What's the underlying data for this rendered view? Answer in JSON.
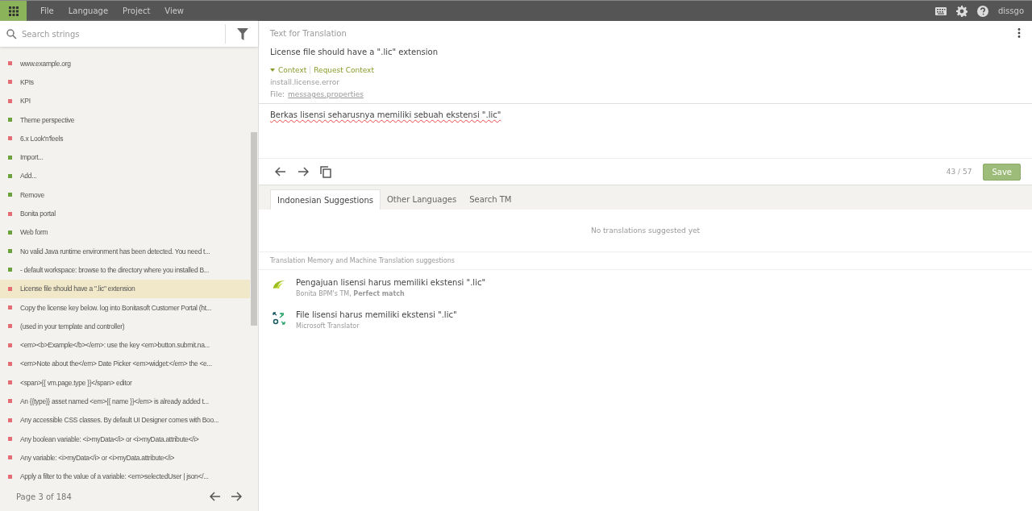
{
  "menu": [
    "File",
    "Language",
    "Project",
    "View"
  ],
  "user": "dissgo",
  "search": {
    "placeholder": "Search strings"
  },
  "strings": [
    {
      "text": "www.example.org",
      "translated": false,
      "selected": false
    },
    {
      "text": "KPIs",
      "translated": false,
      "selected": false
    },
    {
      "text": "KPI",
      "translated": false,
      "selected": false
    },
    {
      "text": "Theme perspective",
      "translated": true,
      "selected": false
    },
    {
      "text": "6.x Look'n'feels",
      "translated": false,
      "selected": false
    },
    {
      "text": "Import...",
      "translated": true,
      "selected": false
    },
    {
      "text": "Add...",
      "translated": true,
      "selected": false
    },
    {
      "text": "Remove",
      "translated": true,
      "selected": false
    },
    {
      "text": "Bonita portal",
      "translated": false,
      "selected": false
    },
    {
      "text": "Web form",
      "translated": true,
      "selected": false
    },
    {
      "text": "No valid Java runtime environment has been detected. You need t...",
      "translated": true,
      "selected": false
    },
    {
      "text": "- default workspace: browse to the directory where you installed B...",
      "translated": true,
      "selected": false
    },
    {
      "text": "License file should have a \".lic\" extension",
      "translated": false,
      "selected": true
    },
    {
      "text": "Copy the license key below. log into Bonitasoft Customer Portal (ht...",
      "translated": false,
      "selected": false
    },
    {
      "text": "(used in your template and controller)",
      "translated": false,
      "selected": false
    },
    {
      "text": "<em><b>Example</b></em>: use the key <em>button.submit.na...",
      "translated": false,
      "selected": false
    },
    {
      "text": "<em>Note about the</em> Date Picker <em>widget:</em> the <e...",
      "translated": false,
      "selected": false
    },
    {
      "text": "<span>{{ vm.page.type }}</span> editor",
      "translated": false,
      "selected": false
    },
    {
      "text": "An {{type}} asset named <em>{{ name }}</em> is already added t...",
      "translated": false,
      "selected": false
    },
    {
      "text": "Any accessible CSS classes. By default UI Designer comes with Boo...",
      "translated": false,
      "selected": false
    },
    {
      "text": "Any boolean variable: <i>myData</i> or <i>myData.attribute</i>",
      "translated": false,
      "selected": false
    },
    {
      "text": "Any variable: <i>myData</i> or <i>myData.attribute</i>",
      "translated": false,
      "selected": false
    },
    {
      "text": "Apply a filter to the value of a variable: <em>selectedUser | json</...",
      "translated": false,
      "selected": false
    }
  ],
  "pager": "Page 3 of 184",
  "source": {
    "heading": "Text for Translation",
    "text": "License file should have a \".lic\" extension",
    "context_toggle": "Context",
    "request_context": "Request Context",
    "key": "install.license.error",
    "file_label": "File:",
    "file": "messages.properties"
  },
  "translation": {
    "value": "Berkas lisensi seharusnya memiliki sebuah ekstensi \".lic\"",
    "counter": "43 / 57",
    "save": "Save"
  },
  "tabs": [
    {
      "label": "Indonesian Suggestions",
      "selected": true
    },
    {
      "label": "Other Languages",
      "selected": false
    },
    {
      "label": "Search TM",
      "selected": false
    }
  ],
  "empty_message": "No translations suggested yet",
  "suggestions_heading": "Translation Memory and Machine Translation suggestions",
  "suggestions": [
    {
      "kind": "tm",
      "text": "Pengajuan lisensi harus memiliki ekstensi \".lic\"",
      "source": "Bonita BPM's TM, **Perfect match**"
    },
    {
      "kind": "mt",
      "text": "File lisensi harus memiliki ekstensi \".lic\"",
      "source": "Microsoft Translator"
    }
  ]
}
